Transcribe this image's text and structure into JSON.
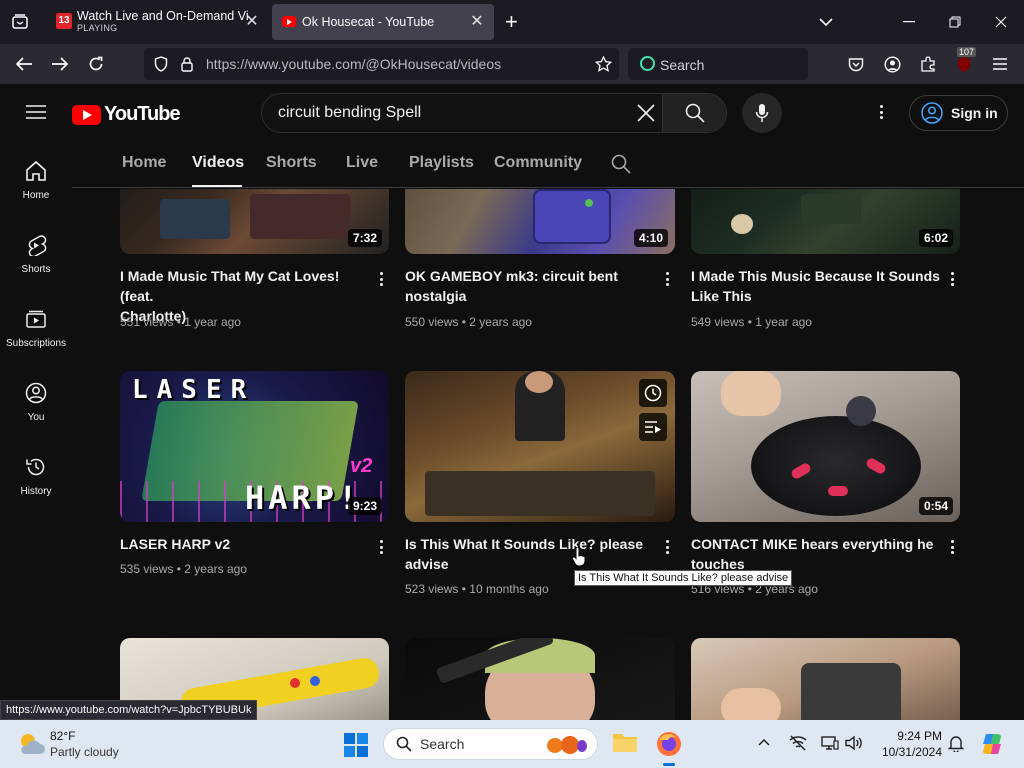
{
  "browser": {
    "tabs": [
      {
        "title": "Watch Live and On-Demand Vi",
        "subtitle": "PLAYING",
        "active": false
      },
      {
        "title": "Ok Housecat - YouTube",
        "active": true
      }
    ],
    "new_tab_symbol": "+",
    "url": "https://www.youtube.com/@OkHousecat/videos",
    "search_placeholder": "Search",
    "extension_badge": "107",
    "status_url": "https://www.youtube.com/watch?v=JpbcTYBUBUk"
  },
  "youtube": {
    "logo_text": "YouTube",
    "search_query": "circuit bending Spell",
    "sign_in": "Sign in",
    "rail": [
      {
        "label": "Home",
        "icon": "home-icon"
      },
      {
        "label": "Shorts",
        "icon": "shorts-icon"
      },
      {
        "label": "Subscriptions",
        "icon": "subscriptions-icon"
      },
      {
        "label": "You",
        "icon": "you-icon"
      },
      {
        "label": "History",
        "icon": "history-icon"
      }
    ],
    "channel_tabs": [
      "Home",
      "Videos",
      "Shorts",
      "Live",
      "Playlists",
      "Community"
    ],
    "active_tab": "Videos",
    "videos": [
      {
        "title_l1": "I Made Music That My Cat Loves! (feat.",
        "title_l2": "Charlotte)",
        "views": "551 views",
        "age": "1 year ago",
        "duration": "7:32"
      },
      {
        "title_l1": "OK GAMEBOY mk3: circuit bent",
        "title_l2": "nostalgia",
        "views": "550 views",
        "age": "2 years ago",
        "duration": "4:10"
      },
      {
        "title_l1": "I Made This Music Because It Sounds",
        "title_l2": "Like This",
        "views": "549 views",
        "age": "1 year ago",
        "duration": "6:02"
      },
      {
        "title_l1": "LASER HARP v2",
        "title_l2": "",
        "views": "535 views",
        "age": "2 years ago",
        "duration": "9:23",
        "thumb_text_top": "LASER",
        "thumb_text_bottom": "HARP!",
        "thumb_badge": "v2"
      },
      {
        "title_l1": "Is This What It Sounds Like? please",
        "title_l2": "advise",
        "views": "523 views",
        "age": "10 months ago",
        "duration": ""
      },
      {
        "title_l1": "CONTACT MIKE hears everything he",
        "title_l2": "touches",
        "views": "516 views",
        "age": "2 years ago",
        "duration": "0:54"
      }
    ],
    "tooltip": "Is This What It Sounds Like?  please advise"
  },
  "taskbar": {
    "temp": "82°F",
    "weather": "Partly cloudy",
    "search": "Search",
    "time": "9:24 PM",
    "date": "10/31/2024"
  },
  "colors": {
    "yt_red": "#ff0000",
    "bg": "#0f0f0f",
    "taskbar": "#dfe7f2"
  }
}
